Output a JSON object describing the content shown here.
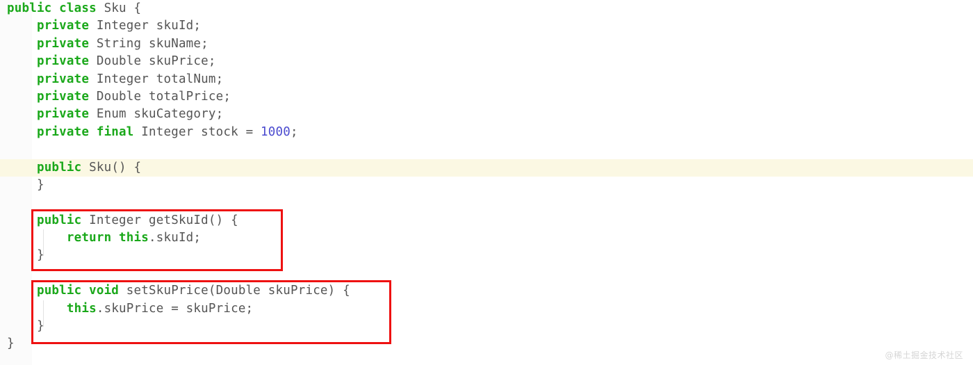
{
  "editor": {
    "language": "java",
    "background_color": "#ffffff",
    "keyword_color": "#1aa81a",
    "text_color": "#555555",
    "number_color": "#4b4bcf",
    "highlight_color": "#fbf8e3",
    "annotation_color": "#ee1111",
    "lines": [
      {
        "indent": 0,
        "tokens": [
          {
            "t": "kw",
            "v": "public class"
          },
          {
            "t": "plain",
            "v": " Sku {"
          }
        ]
      },
      {
        "indent": 1,
        "tokens": [
          {
            "t": "kw",
            "v": "private"
          },
          {
            "t": "plain",
            "v": " Integer skuId;"
          }
        ]
      },
      {
        "indent": 1,
        "tokens": [
          {
            "t": "kw",
            "v": "private"
          },
          {
            "t": "plain",
            "v": " String skuName;"
          }
        ]
      },
      {
        "indent": 1,
        "tokens": [
          {
            "t": "kw",
            "v": "private"
          },
          {
            "t": "plain",
            "v": " Double skuPrice;"
          }
        ]
      },
      {
        "indent": 1,
        "tokens": [
          {
            "t": "kw",
            "v": "private"
          },
          {
            "t": "plain",
            "v": " Integer totalNum;"
          }
        ]
      },
      {
        "indent": 1,
        "tokens": [
          {
            "t": "kw",
            "v": "private"
          },
          {
            "t": "plain",
            "v": " Double totalPrice;"
          }
        ]
      },
      {
        "indent": 1,
        "tokens": [
          {
            "t": "kw",
            "v": "private"
          },
          {
            "t": "plain",
            "v": " Enum skuCategory;"
          }
        ]
      },
      {
        "indent": 1,
        "tokens": [
          {
            "t": "kw",
            "v": "private final"
          },
          {
            "t": "plain",
            "v": " Integer stock = "
          },
          {
            "t": "num",
            "v": "1000"
          },
          {
            "t": "plain",
            "v": ";"
          }
        ]
      },
      {
        "indent": 0,
        "tokens": []
      },
      {
        "indent": 1,
        "highlighted": true,
        "tokens": [
          {
            "t": "kw",
            "v": "public"
          },
          {
            "t": "plain",
            "v": " Sku() {"
          }
        ]
      },
      {
        "indent": 1,
        "tokens": [
          {
            "t": "plain",
            "v": "}"
          }
        ]
      },
      {
        "indent": 0,
        "tokens": []
      },
      {
        "indent": 1,
        "tokens": [
          {
            "t": "kw",
            "v": "public"
          },
          {
            "t": "plain",
            "v": " Integer getSkuId() {"
          }
        ]
      },
      {
        "indent": 2,
        "tokens": [
          {
            "t": "kw",
            "v": "return this"
          },
          {
            "t": "plain",
            "v": ".skuId;"
          }
        ]
      },
      {
        "indent": 1,
        "tokens": [
          {
            "t": "plain",
            "v": "}"
          }
        ]
      },
      {
        "indent": 0,
        "tokens": []
      },
      {
        "indent": 1,
        "tokens": [
          {
            "t": "kw",
            "v": "public void"
          },
          {
            "t": "plain",
            "v": " setSkuPrice(Double skuPrice) {"
          }
        ]
      },
      {
        "indent": 2,
        "tokens": [
          {
            "t": "kw",
            "v": "this"
          },
          {
            "t": "plain",
            "v": ".skuPrice = skuPrice;"
          }
        ]
      },
      {
        "indent": 1,
        "tokens": [
          {
            "t": "plain",
            "v": "}"
          }
        ]
      },
      {
        "indent": 0,
        "tokens": [
          {
            "t": "plain",
            "v": "}"
          }
        ]
      }
    ]
  },
  "annotations": [
    {
      "id": "getter",
      "label": "getSkuId-method-highlight",
      "color": "#ee1111"
    },
    {
      "id": "setter",
      "label": "setSkuPrice-method-highlight",
      "color": "#ee1111"
    }
  ],
  "watermark": {
    "text": "@稀土掘金技术社区"
  }
}
